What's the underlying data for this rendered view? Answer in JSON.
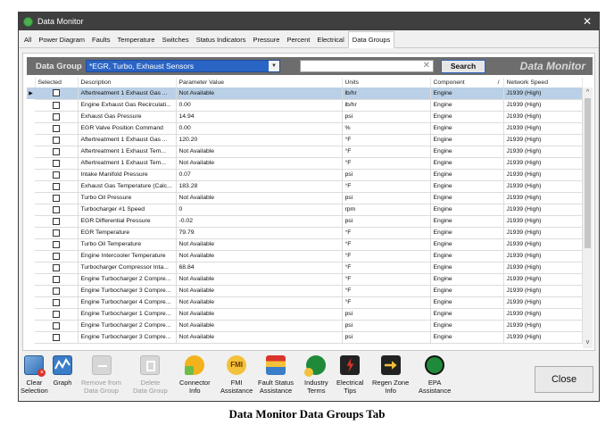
{
  "window": {
    "title": "Data Monitor",
    "close_glyph": "✕"
  },
  "tabs": [
    {
      "label": "All"
    },
    {
      "label": "Power Diagram"
    },
    {
      "label": "Faults"
    },
    {
      "label": "Temperature"
    },
    {
      "label": "Switches"
    },
    {
      "label": "Status Indicators"
    },
    {
      "label": "Pressure"
    },
    {
      "label": "Percent"
    },
    {
      "label": "Electrical"
    },
    {
      "label": "Data Groups",
      "active": true
    }
  ],
  "group_bar": {
    "label": "Data Group",
    "selected_group": "*EGR, Turbo, Exhaust Sensors",
    "search_value": "",
    "search_button": "Search",
    "brand": "Data Monitor"
  },
  "table": {
    "columns": [
      "Selected",
      "Description",
      "Parameter Value",
      "Units",
      "Component",
      "Network Speed"
    ],
    "rows": [
      [
        "Aftertreatment 1 Exhaust Gas ...",
        "Not Available",
        "lb/hr",
        "Engine",
        "J1939 (High)"
      ],
      [
        "Engine Exhaust Gas Recirculati...",
        "0.00",
        "lb/hr",
        "Engine",
        "J1939 (High)"
      ],
      [
        "Exhaust Gas Pressure",
        "14.94",
        "psi",
        "Engine",
        "J1939 (High)"
      ],
      [
        "EGR Valve Position Command",
        "0.00",
        "%",
        "Engine",
        "J1939 (High)"
      ],
      [
        "Aftertreatment 1 Exhaust Gas ...",
        "120.20",
        "°F",
        "Engine",
        "J1939 (High)"
      ],
      [
        "Aftertreatment 1 Exhaust Tem...",
        "Not Available",
        "°F",
        "Engine",
        "J1939 (High)"
      ],
      [
        "Aftertreatment 1 Exhaust Tem...",
        "Not Available",
        "°F",
        "Engine",
        "J1939 (High)"
      ],
      [
        "Intake Manifold Pressure",
        "0.07",
        "psi",
        "Engine",
        "J1939 (High)"
      ],
      [
        "Exhaust Gas Temperature (Calc...",
        "183.28",
        "°F",
        "Engine",
        "J1939 (High)"
      ],
      [
        "Turbo Oil Pressure",
        "Not Available",
        "psi",
        "Engine",
        "J1939 (High)"
      ],
      [
        "Turbocharger #1 Speed",
        "0",
        "rpm",
        "Engine",
        "J1939 (High)"
      ],
      [
        "EGR Differential Pressure",
        "-0.02",
        "psi",
        "Engine",
        "J1939 (High)"
      ],
      [
        "EGR Temperature",
        "79.79",
        "°F",
        "Engine",
        "J1939 (High)"
      ],
      [
        "Turbo Oil Temperature",
        "Not Available",
        "°F",
        "Engine",
        "J1939 (High)"
      ],
      [
        "Engine Intercooler Temperature",
        "Not Available",
        "°F",
        "Engine",
        "J1939 (High)"
      ],
      [
        "Turbocharger Compressor Inta...",
        "68.84",
        "°F",
        "Engine",
        "J1939 (High)"
      ],
      [
        "Engine Turbocharger 2 Compre...",
        "Not Available",
        "°F",
        "Engine",
        "J1939 (High)"
      ],
      [
        "Engine Turbocharger 3 Compre...",
        "Not Available",
        "°F",
        "Engine",
        "J1939 (High)"
      ],
      [
        "Engine Turbocharger 4 Compre...",
        "Not Available",
        "°F",
        "Engine",
        "J1939 (High)"
      ],
      [
        "Engine Turbocharger 1 Compre...",
        "Not Available",
        "psi",
        "Engine",
        "J1939 (High)"
      ],
      [
        "Engine Turbocharger 2 Compre...",
        "Not Available",
        "psi",
        "Engine",
        "J1939 (High)"
      ],
      [
        "Engine Turbocharger 3 Compre...",
        "Not Available",
        "psi",
        "Engine",
        "J1939 (High)"
      ]
    ]
  },
  "toolbar": {
    "clear_selection": "Clear\nSelection",
    "graph": "Graph",
    "remove_from_group": "Remove from\nData Group",
    "delete_group": "Delete\nData Group",
    "connector_info": "Connector\nInfo",
    "fmi_assistance": "FMI\nAssistance",
    "fault_status_assistance": "Fault Status\nAssistance",
    "industry_terms": "Industry\nTerms",
    "electrical_tips": "Electrical\nTips",
    "regen_zone_info": "Regen Zone\nInfo",
    "epa_assistance": "EPA\nAssistance",
    "close": "Close",
    "icon_labels": {
      "fmi": "FMI"
    }
  },
  "caption": "Data Monitor Data Groups Tab",
  "colors": {
    "selected_row": "#bad0e6",
    "group_select": "#2a64c4",
    "titlebar": "#3f3f3f"
  }
}
